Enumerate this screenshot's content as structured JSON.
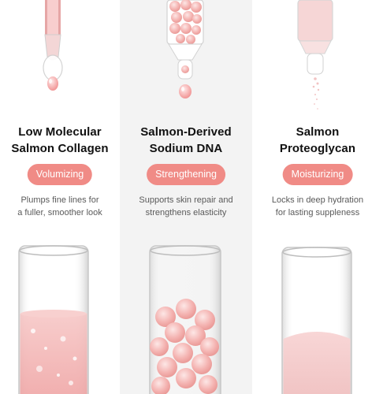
{
  "benefits": [
    {
      "title_line1": "Low Molecular",
      "title_line2": "Salmon Collagen",
      "badge": "Volumizing",
      "desc_line1": "Plumps fine lines for",
      "desc_line2": "a fuller, smoother look",
      "illustration": "pink-liquid-dropper-and-vial"
    },
    {
      "title_line1": "Salmon-Derived",
      "title_line2": "Sodium DNA",
      "badge": "Strengthening",
      "desc_line1": "Supports skin repair and",
      "desc_line2": "strengthens elasticity",
      "illustration": "pink-beads-dropper-and-vial"
    },
    {
      "title_line1": "Salmon",
      "title_line2": "Proteoglycan",
      "badge": "Moisturizing",
      "desc_line1": "Locks in deep hydration",
      "desc_line2": "for lasting suppleness",
      "illustration": "pink-powder-dropper-and-vial"
    }
  ],
  "colors": {
    "badge": "#f08b86",
    "middle_panel": "#f3f3f3",
    "title": "#111111",
    "description": "#5a5a5a"
  }
}
